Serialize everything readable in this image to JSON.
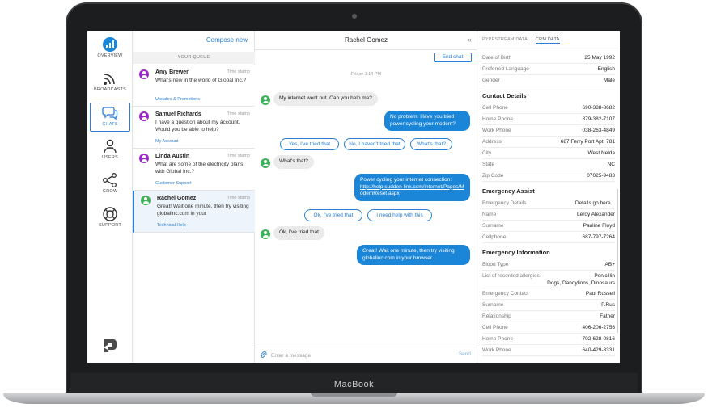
{
  "device": {
    "label": "MacBook"
  },
  "nav": {
    "items": [
      {
        "label": "OVERVIEW",
        "icon": "chart-badge-icon"
      },
      {
        "label": "BROADCASTS",
        "icon": "broadcast-icon"
      },
      {
        "label": "CHATS",
        "icon": "chat-bubbles-icon"
      },
      {
        "label": "USERS",
        "icon": "users-icon"
      },
      {
        "label": "GROW",
        "icon": "share-nodes-icon"
      },
      {
        "label": "SUPPORT",
        "icon": "lifebuoy-icon"
      }
    ],
    "active": "CHATS"
  },
  "queue": {
    "compose_label": "Compose new",
    "header": "YOUR QUEUE",
    "items": [
      {
        "name": "Amy Brewer",
        "time": "Time stamp",
        "message": "What's new in the world of Global Inc.?",
        "tag": "Updates & Promotions",
        "avatar_color": "#9b27c9"
      },
      {
        "name": "Samuel Richards",
        "time": "Time stamp",
        "message": "I have a question about my account. Would you be able to help?",
        "tag": "My Account",
        "avatar_color": "#9b27c9"
      },
      {
        "name": "Linda Austin",
        "time": "Time stamp",
        "message": "What are some of the electricity plans with Global Inc.?",
        "tag": "Customer Support",
        "avatar_color": "#9b27c9"
      },
      {
        "name": "Rachel Gomez",
        "time": "Time stamp",
        "message": "Great! Wait one minute, then try visiting globalinc.com in your",
        "tag": "Technical Help",
        "avatar_color": "#3fb25b"
      }
    ]
  },
  "chat": {
    "title": "Rachel Gomez",
    "end_chat_label": "End chat",
    "day_label": "Friday 1:14 PM",
    "messages": [
      {
        "text": "My internet went out. Can you help me?"
      },
      {
        "text": "No problem. Have you tried power cycling your modem?"
      },
      {
        "text": "What's that?"
      },
      {
        "text": "Power cycling your internet connection:",
        "link": "http://help.sudden-link.com/internet/Pages/ModemReset.aspx"
      },
      {
        "text": "Ok, I've tried that"
      },
      {
        "text": "Great! Wait one minute, then try visiting globalinc.com in your browser."
      }
    ],
    "quick_replies_1": [
      "Yes, I've tried that",
      "No, I haven't tried that",
      "What's that?"
    ],
    "quick_replies_2": [
      "Ok, I've tried that",
      "I need help with this"
    ],
    "input_placeholder": "Enter a message",
    "send_label": "Send"
  },
  "crm": {
    "tabs": [
      "PYPESTREAM DATA",
      "CRM DATA"
    ],
    "active_tab": "CRM DATA",
    "profile": [
      {
        "k": "Date of Birth",
        "v": "25 May 1992"
      },
      {
        "k": "Preferred Language",
        "v": "English"
      },
      {
        "k": "Gender",
        "v": "Male"
      }
    ],
    "contact_title": "Contact Details",
    "contact": [
      {
        "k": "Cell Phone",
        "v": "690-388-8682"
      },
      {
        "k": "Home Phone",
        "v": "879-382-7107"
      },
      {
        "k": "Work Phone",
        "v": "038-263-4849"
      },
      {
        "k": "Address",
        "v": "687 Ferry Port Apt. 781"
      },
      {
        "k": "City",
        "v": "West Nelda"
      },
      {
        "k": "State",
        "v": "NC"
      },
      {
        "k": "Zip Code",
        "v": "07025-9483"
      }
    ],
    "assist_title": "Emergency Assist",
    "assist": [
      {
        "k": "Emergency Details",
        "v": "Details go here..."
      },
      {
        "k": "Name",
        "v": "Leroy Alexander"
      },
      {
        "k": "Surname",
        "v": "Pauline Floyd"
      },
      {
        "k": "Cellphone",
        "v": "687-797-7264"
      }
    ],
    "info_title": "Emergency Information",
    "info": [
      {
        "k": "Blood Type",
        "v": "AB+"
      },
      {
        "k": "List of recorded allergies",
        "v": "Penicillin",
        "v2": "Dogs, Dandylions, Dinosaurs"
      },
      {
        "k": "Emergency Contact",
        "v": "Paul Russell"
      },
      {
        "k": "Surname",
        "v": "P.Rus"
      },
      {
        "k": "Relationship",
        "v": "Father"
      },
      {
        "k": "Cell Phone",
        "v": "406-206-2756"
      },
      {
        "k": "Home Phone",
        "v": "702-628-0816"
      },
      {
        "k": "Work Phone",
        "v": "640-429-8331"
      }
    ]
  }
}
